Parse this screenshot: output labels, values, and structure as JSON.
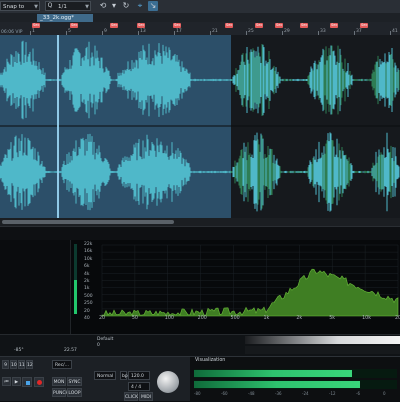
{
  "toolbar": {
    "snap_label": "Snap to objects",
    "grid_label": "1/1",
    "undo_icon": "undo-icon",
    "redo_icon": "redo-icon"
  },
  "tabs": [
    {
      "label": "_33_2k.ogg*"
    }
  ],
  "ruler": {
    "ticks": [
      "1",
      "5",
      "9",
      "13",
      "17",
      "21",
      "25",
      "29",
      "33",
      "37",
      "41"
    ],
    "left_label": "06:06 VIP"
  },
  "analyzer": {
    "db_labels": [
      "22k",
      "16k",
      "10k",
      "6k",
      "4k",
      "2k",
      "1k",
      "500",
      "250",
      "20",
      "40"
    ],
    "hz_labels": [
      "20",
      "50",
      "100",
      "200",
      "500",
      "1k",
      "2k",
      "5k",
      "10k",
      "20k"
    ]
  },
  "status": {
    "left_value": "-85°",
    "mid_value": "22.57",
    "offset_label": "Default",
    "offset_value": "0"
  },
  "transport": {
    "position_numbers": [
      "9",
      "10",
      "11",
      "12"
    ],
    "mode": "Rec/...",
    "tempo_mode": "Normal",
    "bpm_label": "bpm",
    "bpm_value": "120.0",
    "sig_value": "4 / 4",
    "buttons": {
      "mon": "MON",
      "sync": "SYNC",
      "punch": "PUNCH",
      "loop": "LOOP",
      "click": "CLICK",
      "midi": "MIDI"
    }
  },
  "visualization": {
    "title": "Visualization",
    "scale_labels": [
      "-80",
      "-60",
      "-48",
      "-36",
      "-24",
      "-12",
      "-6",
      "0"
    ]
  },
  "colors": {
    "selection": "#2c4f69",
    "waveform": "#4fb8c9",
    "waveform_accent": "#2e7d54",
    "spectrum": "#4a8c2a",
    "record": "#e02828"
  }
}
